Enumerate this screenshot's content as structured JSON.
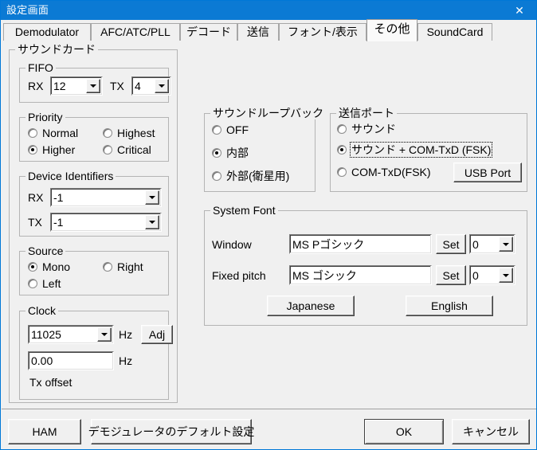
{
  "window": {
    "title": "設定画面",
    "close_label": "✕"
  },
  "tabs": [
    {
      "label": "Demodulator",
      "active": false
    },
    {
      "label": "AFC/ATC/PLL",
      "active": false
    },
    {
      "label": "デコード",
      "active": false
    },
    {
      "label": "送信",
      "active": false
    },
    {
      "label": "フォント/表示",
      "active": false
    },
    {
      "label": "その他",
      "active": true
    },
    {
      "label": "SoundCard",
      "active": false
    }
  ],
  "soundcard": {
    "legend": "サウンドカード",
    "fifo": {
      "legend": "FIFO",
      "rx_label": "RX",
      "rx_value": "12",
      "tx_label": "TX",
      "tx_value": "4"
    },
    "priority": {
      "legend": "Priority",
      "options": [
        {
          "label": "Normal",
          "selected": false
        },
        {
          "label": "Highest",
          "selected": false
        },
        {
          "label": "Higher",
          "selected": true
        },
        {
          "label": "Critical",
          "selected": false
        }
      ]
    },
    "device_identifiers": {
      "legend": "Device Identifiers",
      "rx_label": "RX",
      "rx_value": "-1",
      "tx_label": "TX",
      "tx_value": "-1"
    },
    "source": {
      "legend": "Source",
      "options": [
        {
          "label": "Mono",
          "selected": true
        },
        {
          "label": "Right",
          "selected": false
        },
        {
          "label": "Left",
          "selected": false
        }
      ]
    },
    "clock": {
      "legend": "Clock",
      "rate_value": "11025",
      "rate_unit": "Hz",
      "adj_label": "Adj",
      "offset_value": "0.00",
      "offset_unit": "Hz",
      "offset_label": "Tx offset"
    }
  },
  "loopback": {
    "legend": "サウンドループバック",
    "options": [
      {
        "label": "OFF",
        "selected": false
      },
      {
        "label": "内部",
        "selected": true
      },
      {
        "label": "外部(衛星用)",
        "selected": false
      }
    ]
  },
  "tx_port": {
    "legend": "送信ポート",
    "options": [
      {
        "label": "サウンド",
        "selected": false,
        "focused": false
      },
      {
        "label": "サウンド + COM-TxD (FSK)",
        "selected": true,
        "focused": true
      },
      {
        "label": "COM-TxD(FSK)",
        "selected": false,
        "focused": false
      }
    ],
    "usb_port_label": "USB Port"
  },
  "system_font": {
    "legend": "System Font",
    "window_label": "Window",
    "window_value": "MS Pゴシック",
    "window_set_label": "Set",
    "window_size": "0",
    "fixed_label": "Fixed pitch",
    "fixed_value": "MS ゴシック",
    "fixed_set_label": "Set",
    "fixed_size": "0",
    "japanese_label": "Japanese",
    "english_label": "English"
  },
  "footer": {
    "ham_label": "HAM",
    "demod_default_label": "デモジュレータのデフォルト設定",
    "ok_label": "OK",
    "cancel_label": "キャンセル"
  },
  "colors": {
    "titlebar": "#0b7ad4",
    "dialog_bg": "#f0f0f0",
    "border": "#b4b4b4"
  }
}
